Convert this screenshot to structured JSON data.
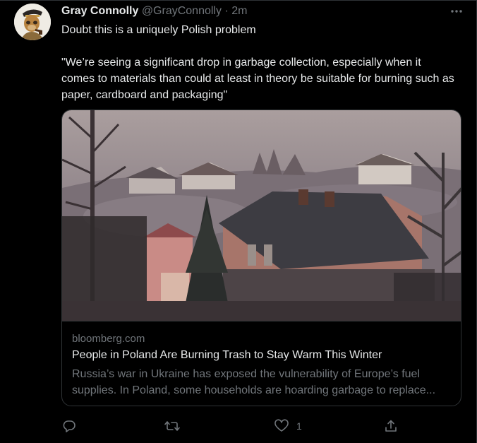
{
  "tweet": {
    "author_name": "Gray Connolly",
    "author_handle": "@GrayConnolly",
    "separator": "·",
    "time": "2m",
    "text_line1": "Doubt this is a uniquely Polish problem",
    "text_quote": "\"We’re seeing a significant drop in garbage collection, especially when it comes to materials than could at least in theory be suitable for burning such as paper, cardboard and packaging\""
  },
  "card": {
    "domain": "bloomberg.com",
    "title": "People in Poland Are Burning Trash to Stay Warm This Winter",
    "description": "Russia’s war in Ukraine has exposed the vulnerability of Europe’s fuel supplies. In Poland, some households are hoarding garbage to replace..."
  },
  "actions": {
    "reply_icon": "reply-icon",
    "retweet_icon": "retweet-icon",
    "like_icon": "heart-icon",
    "like_count": "1",
    "share_icon": "share-icon"
  },
  "colors": {
    "background": "#000000",
    "text_primary": "#e7e9ea",
    "text_secondary": "#71767b",
    "border": "#2f3336"
  }
}
